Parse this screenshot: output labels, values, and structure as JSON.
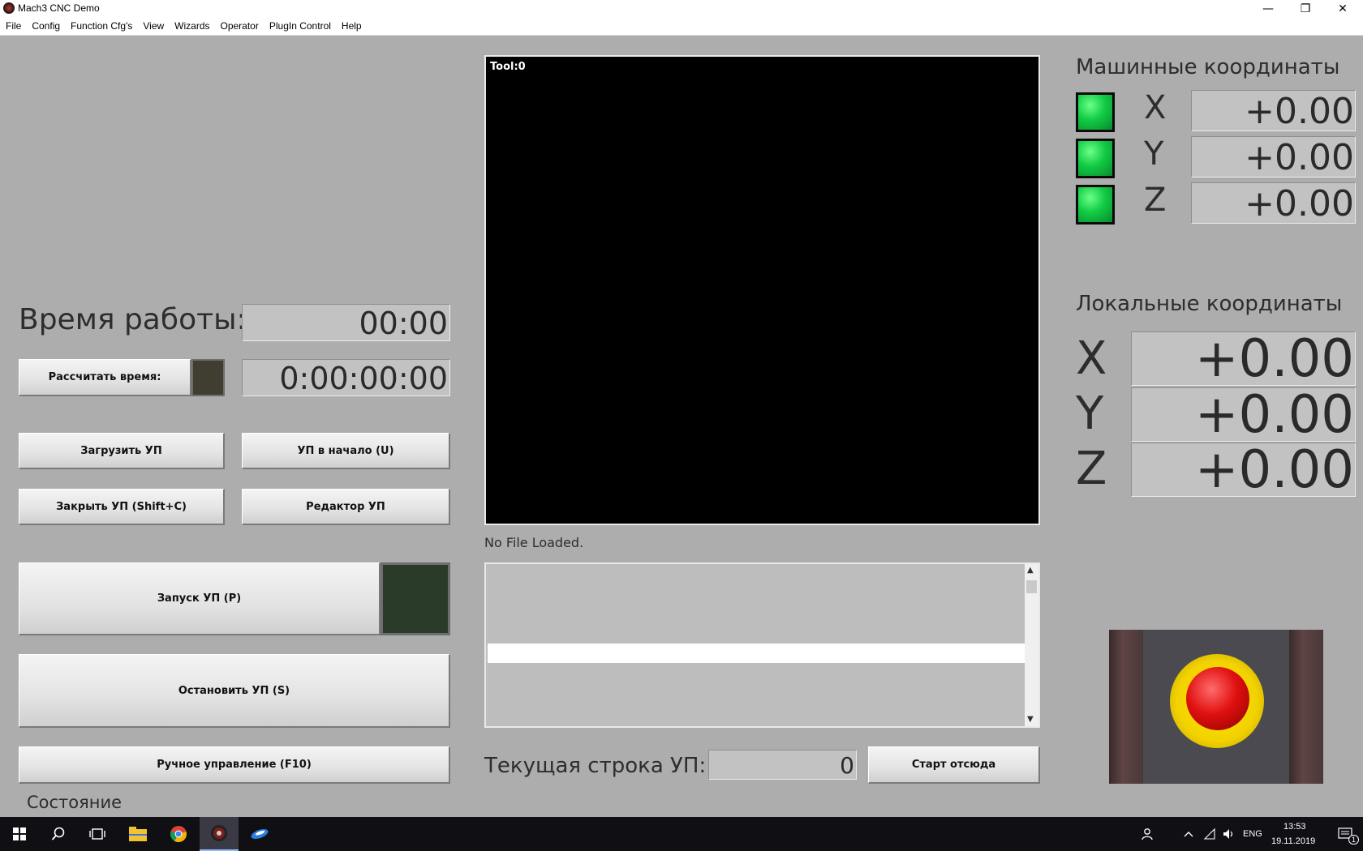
{
  "window": {
    "title": "Mach3 CNC  Demo",
    "minimize_glyph": "—",
    "maximize_glyph": "❐",
    "close_glyph": "✕"
  },
  "menu": [
    "File",
    "Config",
    "Function Cfg's",
    "View",
    "Wizards",
    "Operator",
    "PlugIn Control",
    "Help"
  ],
  "left": {
    "runtime_label": "Время работы:",
    "runtime_value": "00:00",
    "calc_time_button": "Рассчитать время:",
    "calc_time_value": "0:00:00:00",
    "load_gcode_button": "Загрузить УП",
    "rewind_button": "УП в начало (U)",
    "close_gcode_button": "Закрыть УП (Shift+C)",
    "editor_button": "Редактор УП",
    "cycle_start_button": "Запуск УП (P)",
    "stop_button": "Остановить УП (S)",
    "jog_button": "Ручное управление (F10)",
    "status_label": "Состояние"
  },
  "center": {
    "tool_label": "Tool:0",
    "file_status": "No File Loaded.",
    "current_line_label": "Текущая строка УП:",
    "current_line_value": "0",
    "run_from_here_button": "Старт отсюда"
  },
  "right": {
    "machine_coords_title": "Машинные координаты",
    "machine_coords": [
      {
        "axis": "X",
        "value": "+0.00"
      },
      {
        "axis": "Y",
        "value": "+0.00"
      },
      {
        "axis": "Z",
        "value": "+0.00"
      }
    ],
    "local_coords_title": "Локальные координаты",
    "local_coords": [
      {
        "axis": "X",
        "value": "+0.00"
      },
      {
        "axis": "Y",
        "value": "+0.00"
      },
      {
        "axis": "Z",
        "value": "+0.00"
      }
    ]
  },
  "taskbar": {
    "language": "ENG",
    "time": "13:53",
    "date": "19.11.2019",
    "notification_count": "1"
  },
  "colors": {
    "panel_bg": "#adadad",
    "led_green": "#12cc45",
    "estop_red": "#e01010",
    "estop_yellow": "#f2d200"
  }
}
